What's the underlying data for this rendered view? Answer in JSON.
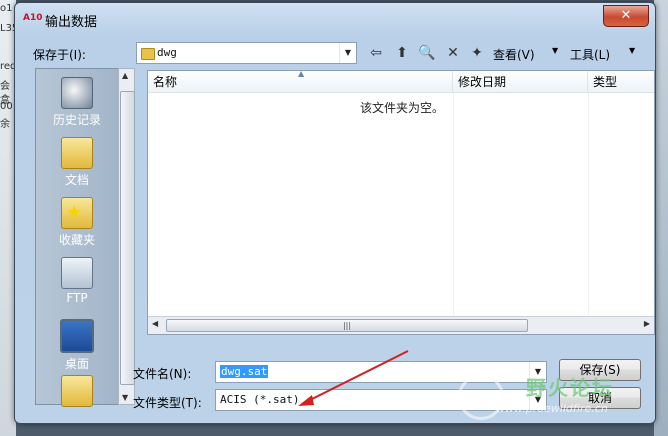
{
  "window": {
    "title": "输出数据",
    "app_icon_text": "A10",
    "close_glyph": "✕"
  },
  "toolbar": {
    "save_in_label": "保存于(I):",
    "current_folder": "dwg",
    "view_label": "查看(V)",
    "tools_label": "工具(L)"
  },
  "places": [
    {
      "label": "历史记录",
      "icon": "history-icon"
    },
    {
      "label": "文档",
      "icon": "documents-folder-icon"
    },
    {
      "label": "收藏夹",
      "icon": "favorites-folder-icon"
    },
    {
      "label": "FTP",
      "icon": "ftp-icon"
    },
    {
      "label": "桌面",
      "icon": "desktop-icon"
    }
  ],
  "filelist": {
    "columns": [
      "名称",
      "修改日期",
      "类型"
    ],
    "empty_message": "该文件夹为空。"
  },
  "bottom": {
    "filename_label": "文件名(N):",
    "filename_value": "dwg.sat",
    "filetype_label": "文件类型(T):",
    "filetype_value": "ACIS (*.sat)",
    "save_button": "保存(S)",
    "cancel_button": "取消"
  },
  "background": {
    "left_fragments": [
      "o1",
      "L35",
      "red",
      "会盒",
      "00",
      "余"
    ]
  },
  "watermark": {
    "text": "野火论坛",
    "url": "www.proewildfire.cn"
  },
  "colors": {
    "annotation_arrow": "#d62020",
    "selection": "#3399ff",
    "close_button": "#c74a32"
  }
}
